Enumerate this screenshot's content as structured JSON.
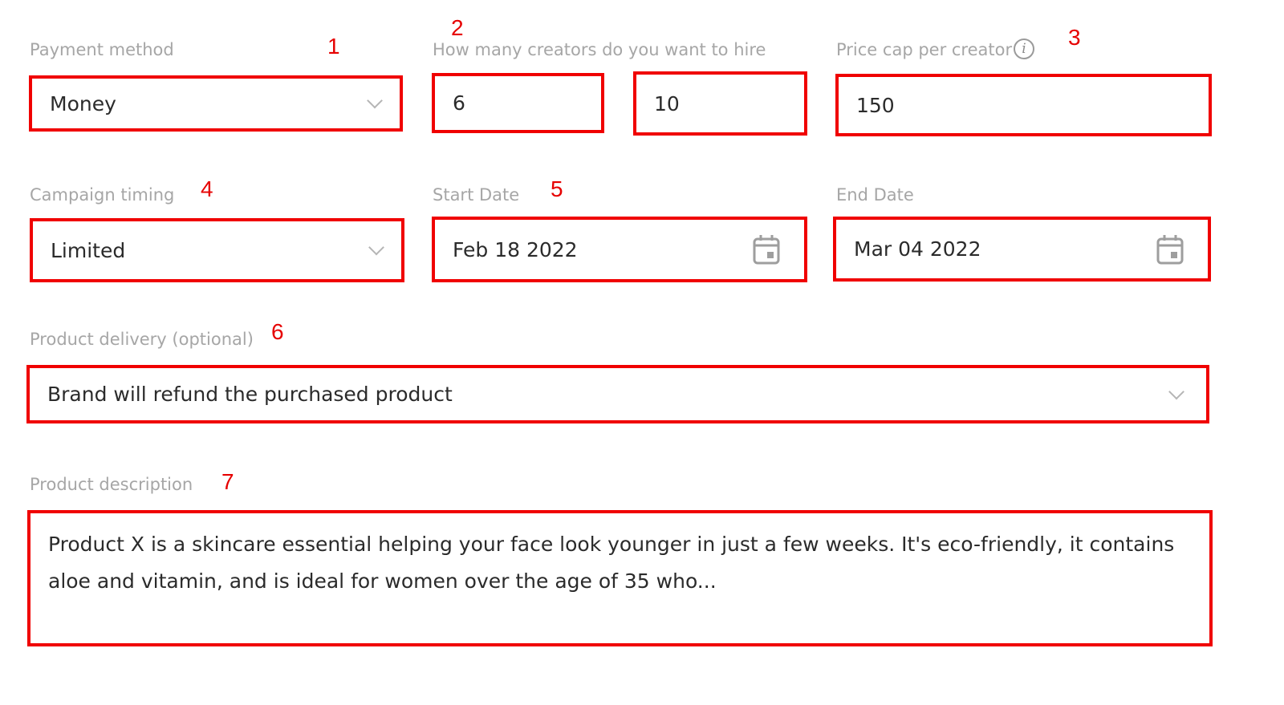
{
  "payment": {
    "label": "Payment method",
    "value": "Money",
    "marker": "1"
  },
  "creators": {
    "label": "How many creators do you want to hire",
    "min": "6",
    "max": "10",
    "marker": "2"
  },
  "price_cap": {
    "label": "Price cap per creator",
    "value": "150",
    "marker": "3"
  },
  "timing": {
    "label": "Campaign timing",
    "value": "Limited",
    "marker": "4"
  },
  "start_date": {
    "label": "Start Date",
    "value": "Feb 18 2022",
    "marker": "5"
  },
  "end_date": {
    "label": "End Date",
    "value": "Mar 04 2022"
  },
  "delivery": {
    "label": "Product delivery (optional)",
    "value": "Brand will refund the purchased product",
    "marker": "6"
  },
  "description": {
    "label": "Product description",
    "value": "Product X is a skincare essential helping your face look younger in just a few weeks. It's eco-friendly, it contains aloe and vitamin, and is ideal for women over the age of 35 who...",
    "marker": "7"
  },
  "icons": [
    "chevron-down-icon",
    "calendar-icon",
    "info-icon"
  ],
  "colors": {
    "highlight": "#f00000",
    "label": "#a6a6a6",
    "text": "#2b2b2b"
  }
}
